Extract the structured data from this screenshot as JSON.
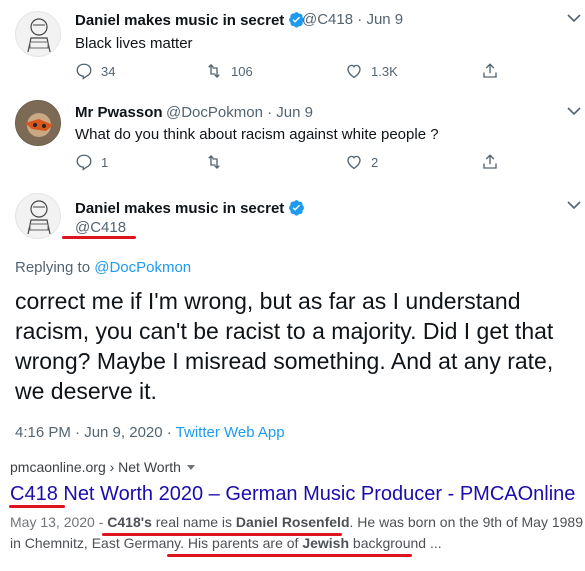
{
  "tweet1": {
    "name": "Daniel makes music in secret",
    "handle": "@C418",
    "date": "Jun 9",
    "text": "Black lives matter",
    "replies": "34",
    "retweets": "106",
    "likes": "1.3K"
  },
  "tweet2": {
    "name": "Mr Pwasson",
    "handle": "@DocPokmon",
    "date": "Jun 9",
    "text": "What do you think about racism against white people ?",
    "replies": "1",
    "retweets": "",
    "likes": "2"
  },
  "tweet3": {
    "name": "Daniel makes music in secret",
    "handle": "@C418",
    "replying_prefix": "Replying to ",
    "replying_to": "@DocPokmon",
    "text": "correct me if I'm wrong, but as far as I understand racism, you can't be racist to a majority. Did I get that wrong? Maybe I misread something. And at any rate, we deserve it.",
    "time": "4:16 PM · Jun 9, 2020 · ",
    "client": "Twitter Web App"
  },
  "search_result": {
    "cite": "pmcaonline.org › Net Worth",
    "title": "C418 Net Worth 2020 – German Music Producer - PMCAOnline",
    "date": "May 13, 2020 - ",
    "s1": "C418's",
    "s2": " real name is ",
    "s3": "Daniel Rosenfeld",
    "s4": ". He was born on the 9th of May 1989 in Chemnitz, East Germany. ",
    "s5": "His parents are of ",
    "s6": "Jewish",
    "s7": " background ..."
  },
  "colors": {
    "link_blue": "#1d9bf0",
    "search_title": "#1a0dab",
    "annotation_red": "#e0141e"
  }
}
